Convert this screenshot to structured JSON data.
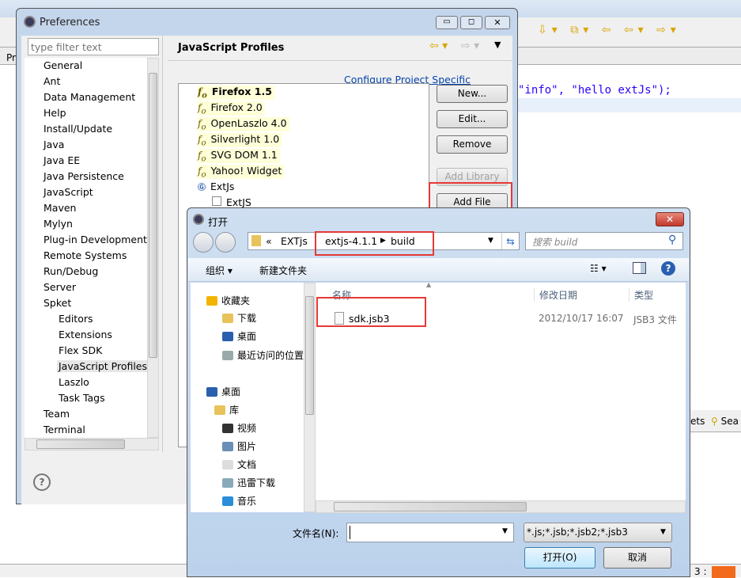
{
  "eclipse": {
    "code_line": "\"info\", \"hello extJs\");",
    "left_label": "Pr",
    "bottom_tab_partial": "ets",
    "bottom_tab_search": "Sea",
    "status_partial": "3 :"
  },
  "preferences": {
    "title": "Preferences",
    "filter_placeholder": "type filter text",
    "tree": [
      {
        "label": "General",
        "level": 0
      },
      {
        "label": "Ant",
        "level": 0
      },
      {
        "label": "Data Management",
        "level": 0
      },
      {
        "label": "Help",
        "level": 0
      },
      {
        "label": "Install/Update",
        "level": 0
      },
      {
        "label": "Java",
        "level": 0
      },
      {
        "label": "Java EE",
        "level": 0
      },
      {
        "label": "Java Persistence",
        "level": 0
      },
      {
        "label": "JavaScript",
        "level": 0
      },
      {
        "label": "Maven",
        "level": 0
      },
      {
        "label": "Mylyn",
        "level": 0
      },
      {
        "label": "Plug-in Development",
        "level": 0
      },
      {
        "label": "Remote Systems",
        "level": 0
      },
      {
        "label": "Run/Debug",
        "level": 0
      },
      {
        "label": "Server",
        "level": 0
      },
      {
        "label": "Spket",
        "level": 0
      },
      {
        "label": "Editors",
        "level": 1
      },
      {
        "label": "Extensions",
        "level": 1
      },
      {
        "label": "Flex SDK",
        "level": 1
      },
      {
        "label": "JavaScript Profiles",
        "level": 1,
        "selected": true
      },
      {
        "label": "Laszlo",
        "level": 1
      },
      {
        "label": "Task Tags",
        "level": 1
      },
      {
        "label": "Team",
        "level": 0
      },
      {
        "label": "Terminal",
        "level": 0
      }
    ],
    "page_title": "JavaScript Profiles",
    "configure_link": "Configure Project Specific Settings...",
    "profiles": [
      {
        "label": "Firefox 1.5",
        "bold": true
      },
      {
        "label": "Firefox 2.0"
      },
      {
        "label": "OpenLaszlo 4.0"
      },
      {
        "label": "Silverlight 1.0"
      },
      {
        "label": "SVG DOM 1.1"
      },
      {
        "label": "Yahoo! Widget"
      }
    ],
    "group": {
      "label": "ExtJs",
      "child": "ExtJS"
    },
    "buttons": {
      "new": "New...",
      "edit": "Edit...",
      "remove": "Remove",
      "add_library": "Add Library",
      "add_file": "Add File"
    }
  },
  "open_dialog": {
    "title": "打开",
    "breadcrumb": [
      "EXTjs",
      "extjs-4.1.1",
      "build"
    ],
    "breadcrumb_prefix": "«",
    "search_placeholder": "搜索 build",
    "organize": "组织 ▾",
    "new_folder": "新建文件夹",
    "columns": {
      "name": "名称",
      "date": "修改日期",
      "type": "类型"
    },
    "files": [
      {
        "name": "sdk.jsb3",
        "date": "2012/10/17 16:07",
        "type": "JSB3 文件"
      }
    ],
    "nav": [
      {
        "label": "收藏夹",
        "icon": "star-icon",
        "level": 0
      },
      {
        "label": "下载",
        "icon": "download-folder-icon",
        "level": 1
      },
      {
        "label": "桌面",
        "icon": "desktop-icon",
        "level": 1
      },
      {
        "label": "最近访问的位置",
        "icon": "recent-places-icon",
        "level": 1
      },
      {
        "label": "桌面",
        "icon": "desktop-icon",
        "level": 0
      },
      {
        "label": "库",
        "icon": "library-icon",
        "level": 0.5
      },
      {
        "label": "视频",
        "icon": "video-icon",
        "level": 1
      },
      {
        "label": "图片",
        "icon": "pictures-icon",
        "level": 1
      },
      {
        "label": "文档",
        "icon": "documents-icon",
        "level": 1
      },
      {
        "label": "迅雷下载",
        "icon": "thunder-download-icon",
        "level": 1
      },
      {
        "label": "音乐",
        "icon": "music-icon",
        "level": 1
      }
    ],
    "filename_label": "文件名(N):",
    "filename_value": "",
    "filter": "*.js;*.jsb;*.jsb2;*.jsb3",
    "open_button": "打开(O)",
    "cancel_button": "取消"
  },
  "colors": {
    "highlight": "#e53935",
    "link": "#0645ad",
    "code": "#2a00ff"
  }
}
